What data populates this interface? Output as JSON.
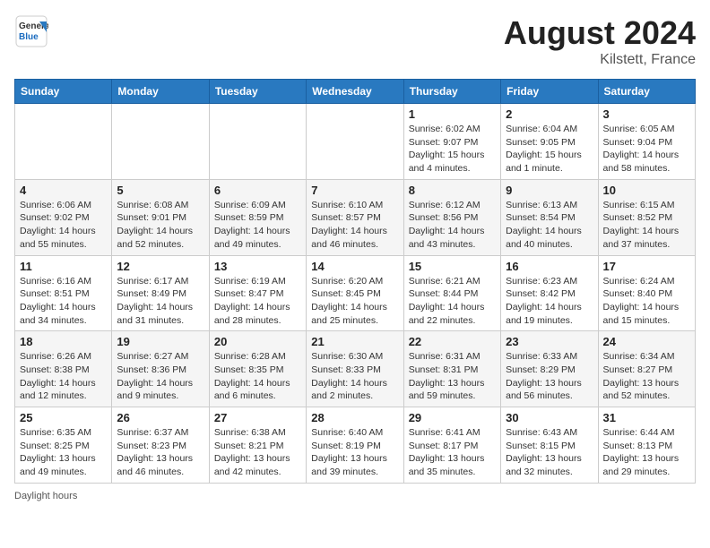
{
  "header": {
    "logo_general": "General",
    "logo_blue": "Blue",
    "month_year": "August 2024",
    "location": "Kilstett, France"
  },
  "days_of_week": [
    "Sunday",
    "Monday",
    "Tuesday",
    "Wednesday",
    "Thursday",
    "Friday",
    "Saturday"
  ],
  "weeks": [
    [
      {
        "day": "",
        "info": ""
      },
      {
        "day": "",
        "info": ""
      },
      {
        "day": "",
        "info": ""
      },
      {
        "day": "",
        "info": ""
      },
      {
        "day": "1",
        "info": "Sunrise: 6:02 AM\nSunset: 9:07 PM\nDaylight: 15 hours\nand 4 minutes."
      },
      {
        "day": "2",
        "info": "Sunrise: 6:04 AM\nSunset: 9:05 PM\nDaylight: 15 hours\nand 1 minute."
      },
      {
        "day": "3",
        "info": "Sunrise: 6:05 AM\nSunset: 9:04 PM\nDaylight: 14 hours\nand 58 minutes."
      }
    ],
    [
      {
        "day": "4",
        "info": "Sunrise: 6:06 AM\nSunset: 9:02 PM\nDaylight: 14 hours\nand 55 minutes."
      },
      {
        "day": "5",
        "info": "Sunrise: 6:08 AM\nSunset: 9:01 PM\nDaylight: 14 hours\nand 52 minutes."
      },
      {
        "day": "6",
        "info": "Sunrise: 6:09 AM\nSunset: 8:59 PM\nDaylight: 14 hours\nand 49 minutes."
      },
      {
        "day": "7",
        "info": "Sunrise: 6:10 AM\nSunset: 8:57 PM\nDaylight: 14 hours\nand 46 minutes."
      },
      {
        "day": "8",
        "info": "Sunrise: 6:12 AM\nSunset: 8:56 PM\nDaylight: 14 hours\nand 43 minutes."
      },
      {
        "day": "9",
        "info": "Sunrise: 6:13 AM\nSunset: 8:54 PM\nDaylight: 14 hours\nand 40 minutes."
      },
      {
        "day": "10",
        "info": "Sunrise: 6:15 AM\nSunset: 8:52 PM\nDaylight: 14 hours\nand 37 minutes."
      }
    ],
    [
      {
        "day": "11",
        "info": "Sunrise: 6:16 AM\nSunset: 8:51 PM\nDaylight: 14 hours\nand 34 minutes."
      },
      {
        "day": "12",
        "info": "Sunrise: 6:17 AM\nSunset: 8:49 PM\nDaylight: 14 hours\nand 31 minutes."
      },
      {
        "day": "13",
        "info": "Sunrise: 6:19 AM\nSunset: 8:47 PM\nDaylight: 14 hours\nand 28 minutes."
      },
      {
        "day": "14",
        "info": "Sunrise: 6:20 AM\nSunset: 8:45 PM\nDaylight: 14 hours\nand 25 minutes."
      },
      {
        "day": "15",
        "info": "Sunrise: 6:21 AM\nSunset: 8:44 PM\nDaylight: 14 hours\nand 22 minutes."
      },
      {
        "day": "16",
        "info": "Sunrise: 6:23 AM\nSunset: 8:42 PM\nDaylight: 14 hours\nand 19 minutes."
      },
      {
        "day": "17",
        "info": "Sunrise: 6:24 AM\nSunset: 8:40 PM\nDaylight: 14 hours\nand 15 minutes."
      }
    ],
    [
      {
        "day": "18",
        "info": "Sunrise: 6:26 AM\nSunset: 8:38 PM\nDaylight: 14 hours\nand 12 minutes."
      },
      {
        "day": "19",
        "info": "Sunrise: 6:27 AM\nSunset: 8:36 PM\nDaylight: 14 hours\nand 9 minutes."
      },
      {
        "day": "20",
        "info": "Sunrise: 6:28 AM\nSunset: 8:35 PM\nDaylight: 14 hours\nand 6 minutes."
      },
      {
        "day": "21",
        "info": "Sunrise: 6:30 AM\nSunset: 8:33 PM\nDaylight: 14 hours\nand 2 minutes."
      },
      {
        "day": "22",
        "info": "Sunrise: 6:31 AM\nSunset: 8:31 PM\nDaylight: 13 hours\nand 59 minutes."
      },
      {
        "day": "23",
        "info": "Sunrise: 6:33 AM\nSunset: 8:29 PM\nDaylight: 13 hours\nand 56 minutes."
      },
      {
        "day": "24",
        "info": "Sunrise: 6:34 AM\nSunset: 8:27 PM\nDaylight: 13 hours\nand 52 minutes."
      }
    ],
    [
      {
        "day": "25",
        "info": "Sunrise: 6:35 AM\nSunset: 8:25 PM\nDaylight: 13 hours\nand 49 minutes."
      },
      {
        "day": "26",
        "info": "Sunrise: 6:37 AM\nSunset: 8:23 PM\nDaylight: 13 hours\nand 46 minutes."
      },
      {
        "day": "27",
        "info": "Sunrise: 6:38 AM\nSunset: 8:21 PM\nDaylight: 13 hours\nand 42 minutes."
      },
      {
        "day": "28",
        "info": "Sunrise: 6:40 AM\nSunset: 8:19 PM\nDaylight: 13 hours\nand 39 minutes."
      },
      {
        "day": "29",
        "info": "Sunrise: 6:41 AM\nSunset: 8:17 PM\nDaylight: 13 hours\nand 35 minutes."
      },
      {
        "day": "30",
        "info": "Sunrise: 6:43 AM\nSunset: 8:15 PM\nDaylight: 13 hours\nand 32 minutes."
      },
      {
        "day": "31",
        "info": "Sunrise: 6:44 AM\nSunset: 8:13 PM\nDaylight: 13 hours\nand 29 minutes."
      }
    ]
  ],
  "footer": {
    "daylight_label": "Daylight hours"
  }
}
